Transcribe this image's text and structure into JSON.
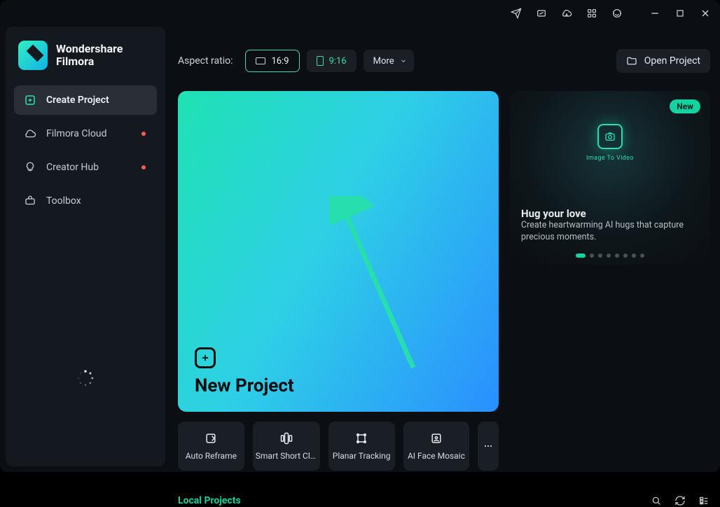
{
  "brand": {
    "line1": "Wondershare",
    "line2": "Filmora"
  },
  "sidebar": {
    "items": [
      {
        "label": "Create Project",
        "icon": "plus-square-icon",
        "active": true,
        "dot": false
      },
      {
        "label": "Filmora Cloud",
        "icon": "cloud-icon",
        "active": false,
        "dot": true
      },
      {
        "label": "Creator Hub",
        "icon": "bulb-icon",
        "active": false,
        "dot": true
      },
      {
        "label": "Toolbox",
        "icon": "toolbox-icon",
        "active": false,
        "dot": false
      }
    ]
  },
  "toolbar": {
    "aspect_label": "Aspect ratio:",
    "ratio_16_9": "16:9",
    "ratio_9_16": "9:16",
    "more_label": "More",
    "open_project": "Open Project"
  },
  "hero": {
    "new_project_label": "New Project"
  },
  "tool_cards": [
    {
      "label": "Auto Reframe",
      "icon": "auto-reframe-icon"
    },
    {
      "label": "Smart Short Cli…",
      "icon": "smart-short-icon"
    },
    {
      "label": "Planar Tracking",
      "icon": "planar-tracking-icon"
    },
    {
      "label": "AI Face Mosaic",
      "icon": "ai-face-mosaic-icon"
    }
  ],
  "promo": {
    "badge": "New",
    "mini_caption": "Image To Video",
    "title": "Hug your love",
    "subtitle": "Create heartwarming AI hugs that capture precious moments.",
    "slide_count": 8,
    "active_slide": 0
  },
  "local": {
    "title": "Local Projects"
  }
}
